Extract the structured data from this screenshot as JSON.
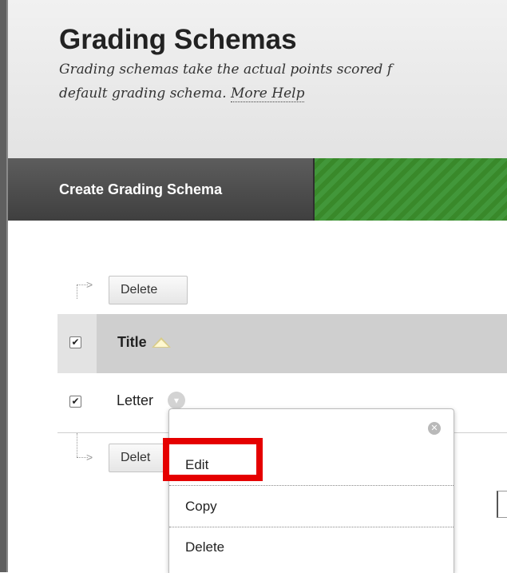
{
  "page": {
    "title": "Grading Schemas",
    "description_line1": "Grading schemas take the actual points scored f",
    "description_line2": "default grading schema.",
    "more_help": "More Help"
  },
  "action_bar": {
    "create_label": "Create Grading Schema"
  },
  "table": {
    "delete_button_top": "Delete",
    "delete_button_bottom": "Delet",
    "header_title": "Title",
    "sort_direction": "ascending",
    "header_checkbox_checked": true,
    "rows": [
      {
        "title": "Letter",
        "checked": true
      }
    ]
  },
  "context_menu": {
    "items": [
      "Edit",
      "Copy",
      "Delete"
    ],
    "highlighted_item": "Edit",
    "highlight_color": "#e50000"
  },
  "icons": [
    "arrow-down-right-icon",
    "sort-ascending-icon",
    "chevron-down-icon",
    "close-icon",
    "checkbox-icon"
  ],
  "colors": {
    "action_bar_green": "#3e9032",
    "action_button": "#4e4e4e",
    "table_header": "#cfcfcf"
  }
}
